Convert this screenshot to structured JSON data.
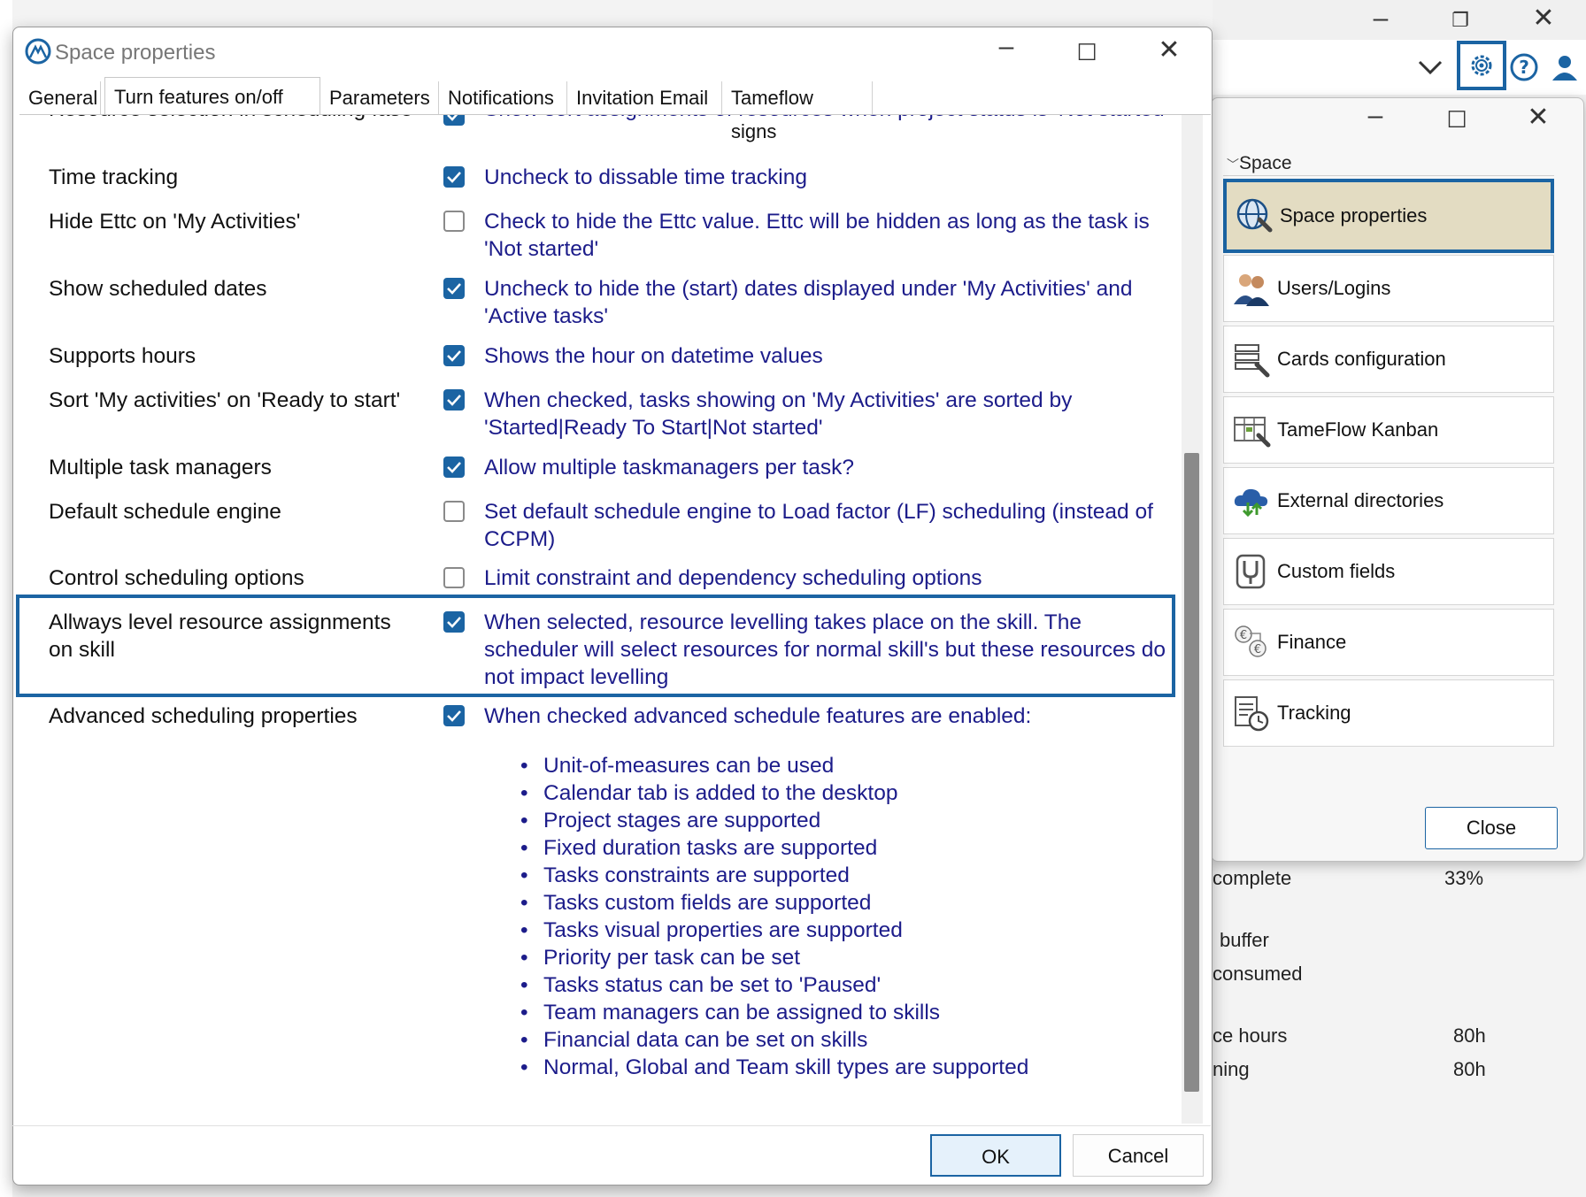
{
  "background": {
    "stats": [
      {
        "label": "complete",
        "value": "33%"
      },
      {
        "label": "buffer",
        "value": ""
      },
      {
        "label": "consumed",
        "value": ""
      },
      {
        "label": "ce hours",
        "value": "80h"
      },
      {
        "label": "ning",
        "value": "80h"
      }
    ]
  },
  "space_window": {
    "header": "Space",
    "items": [
      {
        "label": "Space properties",
        "icon": "globe-wrench-icon"
      },
      {
        "label": "Users/Logins",
        "icon": "users-icon"
      },
      {
        "label": "Cards configuration",
        "icon": "cards-config-icon"
      },
      {
        "label": "TameFlow Kanban",
        "icon": "kanban-icon"
      },
      {
        "label": "External directories",
        "icon": "cloud-directory-icon"
      },
      {
        "label": "Custom fields",
        "icon": "custom-fields-icon"
      },
      {
        "label": "Finance",
        "icon": "finance-icon"
      },
      {
        "label": "Tracking",
        "icon": "tracking-icon"
      }
    ],
    "close_label": "Close"
  },
  "dialog": {
    "title": "Space properties",
    "tabs": [
      "General",
      "Turn features on/off",
      "Parameters",
      "Notifications",
      "Invitation Email",
      "Tameflow signs"
    ],
    "active_tab": "Turn features on/off",
    "rows": [
      {
        "label": "Resource selection in scheduling fase",
        "checked": true,
        "desc": "Show sort assignments of resources when project status is 'Not started'"
      },
      {
        "label": "Time tracking",
        "checked": true,
        "desc": "Uncheck to dissable time tracking"
      },
      {
        "label": "Hide Ettc on 'My Activities'",
        "checked": false,
        "desc": "Check to hide the Ettc value. Ettc will be hidden as long as the task is 'Not started'"
      },
      {
        "label": "Show scheduled dates",
        "checked": true,
        "desc": "Uncheck to hide the (start) dates displayed under 'My Activities' and 'Active tasks'"
      },
      {
        "label": "Supports hours",
        "checked": true,
        "desc": "Shows the hour on datetime values"
      },
      {
        "label": "Sort 'My activities' on 'Ready to start'",
        "checked": true,
        "desc": "When checked, tasks showing on 'My Activities' are sorted by 'Started|Ready To Start|Not started'"
      },
      {
        "label": "Multiple task managers",
        "checked": true,
        "desc": "Allow multiple taskmanagers per task?"
      },
      {
        "label": "Default schedule engine",
        "checked": false,
        "desc": "Set default schedule engine to Load factor (LF) scheduling (instead of CCPM)"
      },
      {
        "label": "Control scheduling options",
        "checked": false,
        "desc": "Limit constraint and dependency scheduling options"
      },
      {
        "label": "Allways level resource assignments on skill",
        "checked": true,
        "desc": "When selected, resource levelling takes place on the skill. The scheduler will select resources for normal skill's but these resources do not impact levelling"
      },
      {
        "label": "Advanced scheduling properties",
        "checked": true,
        "desc": "When checked advanced schedule features are enabled:"
      }
    ],
    "advanced_features": [
      "Unit-of-measures can be used",
      "Calendar tab is added to the desktop",
      "Project stages are supported",
      "Fixed duration tasks are supported",
      "Tasks constraints are supported",
      "Tasks custom fields are supported",
      "Tasks visual properties are supported",
      "Priority per task can be set",
      "Tasks status can be set to 'Paused'",
      "Team managers can be assigned to skills",
      "Financial data can be set on skills",
      "Normal, Global and Team skill types are supported"
    ],
    "ok_label": "OK",
    "cancel_label": "Cancel"
  },
  "colors": {
    "accent": "#1b64a3",
    "desc_text": "#1c1c8a",
    "selected_item": "#e3dcc2"
  }
}
